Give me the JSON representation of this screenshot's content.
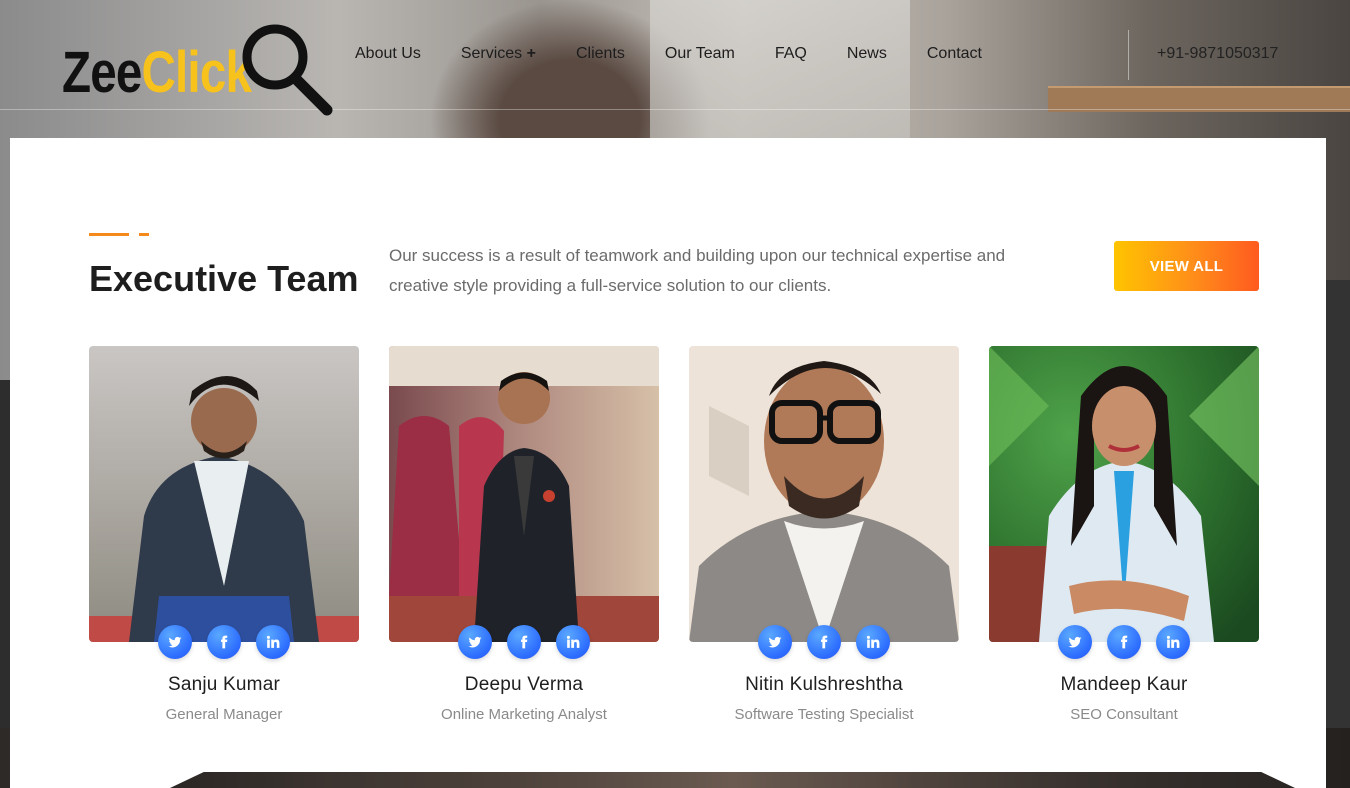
{
  "header": {
    "logo": {
      "part1": "Zee",
      "part2": "Click"
    },
    "nav": [
      {
        "label": "About Us"
      },
      {
        "label": "Services",
        "suffix": "+"
      },
      {
        "label": "Clients"
      },
      {
        "label": "Our Team"
      },
      {
        "label": "FAQ"
      },
      {
        "label": "News"
      },
      {
        "label": "Contact"
      }
    ],
    "phone": "+91-9871050317"
  },
  "section": {
    "title": "Executive Team",
    "description": "Our success is a result of teamwork and building upon our technical expertise and creative style providing a full-service solution to our clients.",
    "button_label": "VIEW ALL"
  },
  "team": [
    {
      "name": "Sanju Kumar",
      "role": "General Manager"
    },
    {
      "name": "Deepu Verma",
      "role": "Online Marketing Analyst"
    },
    {
      "name": "Nitin Kulshreshtha",
      "role": "Software Testing Specialist"
    },
    {
      "name": "Mandeep Kaur",
      "role": "SEO Consultant"
    }
  ],
  "colors": {
    "accent_orange": "#f48a1c",
    "button_gradient_start": "#ffc400",
    "button_gradient_end": "#ff5a1f",
    "social_blue": "#2b6bff",
    "logo_yellow": "#f7c21b"
  },
  "icons": [
    "search-lens-icon",
    "twitter-icon",
    "facebook-icon",
    "linkedin-icon"
  ]
}
